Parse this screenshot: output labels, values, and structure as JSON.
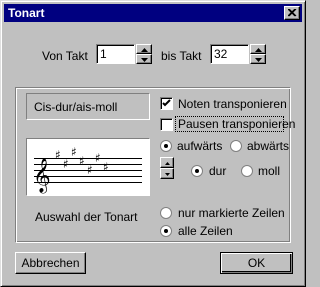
{
  "window": {
    "title": "Tonart"
  },
  "range": {
    "from_label": "Von Takt",
    "from_value": "1",
    "to_label": "bis Takt",
    "to_value": "32"
  },
  "key": {
    "name": "Cis-dur/ais-moll",
    "caption": "Auswahl der Tonart"
  },
  "options": {
    "transpose_notes_label": "Noten transponieren",
    "transpose_notes_checked": true,
    "transpose_rests_label": "Pausen transponieren",
    "transpose_rests_checked": false
  },
  "direction": {
    "up_label": "aufwärts",
    "down_label": "abwärts",
    "selected": "aufwärts"
  },
  "mode": {
    "major_label": "dur",
    "minor_label": "moll",
    "selected": "dur"
  },
  "scope": {
    "marked_label": "nur markierte Zeilen",
    "all_label": "alle Zeilen",
    "selected": "alle Zeilen"
  },
  "buttons": {
    "cancel_label": "Abbrechen",
    "ok_label": "OK"
  }
}
